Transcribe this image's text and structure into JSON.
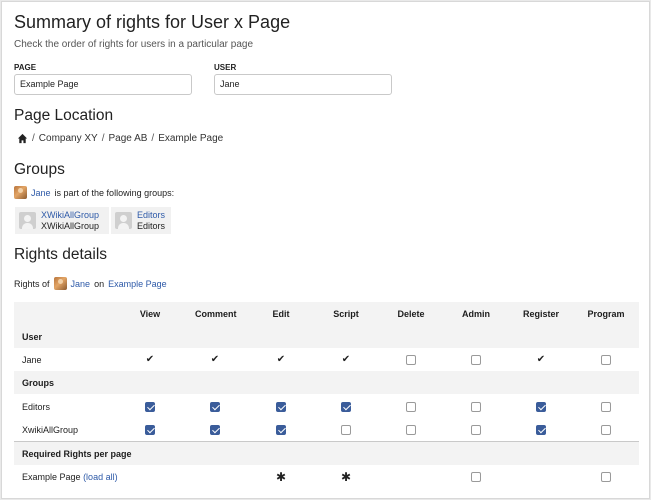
{
  "page": {
    "title": "Summary of rights for User x Page",
    "subtitle": "Check the order of rights for users in a particular page"
  },
  "form": {
    "page_label": "PAGE",
    "page_value": "Example Page",
    "user_label": "USER",
    "user_value": "Jane"
  },
  "location": {
    "heading": "Page Location",
    "crumbs": [
      "Company XY",
      "Page AB",
      "Example Page"
    ],
    "separator": "/"
  },
  "groups": {
    "heading": "Groups",
    "user": "Jane",
    "intro": "is part of the following groups:",
    "items": [
      {
        "name": "XWikiAllGroup",
        "sub": "XWikiAllGroup"
      },
      {
        "name": "Editors",
        "sub": "Editors"
      }
    ]
  },
  "rights": {
    "heading": "Rights details",
    "prefix": "Rights of",
    "user": "Jane",
    "on": "on",
    "page": "Example Page",
    "columns": [
      "View",
      "Comment",
      "Edit",
      "Script",
      "Delete",
      "Admin",
      "Register",
      "Program"
    ],
    "sections": {
      "user": "User",
      "groups": "Groups",
      "required": "Required Rights per page"
    },
    "rows": {
      "user_jane": {
        "label": "Jane",
        "values": [
          "check",
          "check",
          "check",
          "check",
          "box",
          "box",
          "check",
          "box"
        ]
      },
      "editors": {
        "label": "Editors",
        "values": [
          "checked",
          "checked",
          "checked",
          "checked",
          "box",
          "box",
          "checked",
          "box"
        ]
      },
      "xwikiallgroup": {
        "label": "XwikiAllGroup",
        "values": [
          "checked",
          "checked",
          "checked",
          "box",
          "box",
          "box",
          "checked",
          "box"
        ]
      },
      "example_page": {
        "label": "Example Page",
        "load_all": "(load all)",
        "values": [
          "",
          "",
          "star",
          "star",
          "",
          "box",
          "",
          "box"
        ]
      }
    },
    "glyphs": {
      "check": "✔",
      "star": "✱"
    }
  },
  "colors": {
    "link": "#2e5aa8",
    "checkbox_checked": "#3a5c9a",
    "row_shade": "#f3f3f3"
  }
}
